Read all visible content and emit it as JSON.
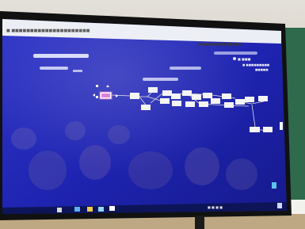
{
  "scene": {
    "description_tag": "photo-of-monitor",
    "colors": {
      "wall_top": "#d9d4cb",
      "wall_bottom": "#cdbfa9",
      "bezel": "#121212",
      "screen_dark": "#1a1a9c",
      "screen_light": "#2f34c8",
      "browser_bar": "#f3f3f6",
      "taskbar": "#0f1a60",
      "board": "#2e6b4e",
      "node": "#f4f4f4",
      "connector": "#dddddd"
    }
  },
  "browser": {
    "tab_text": "■ ■■■■■■■■■■■■■",
    "address_text": "■ ■■■■■■■■■■■■■■■■■■■■■"
  },
  "overlay": {
    "user_label": "■ ■■■",
    "info_lines": [
      "■ ■■■■■■■■■",
      "■■■■■"
    ]
  },
  "mindmap": {
    "root_label": "",
    "node_labels": [
      "",
      "",
      "",
      "",
      "",
      "",
      "",
      "",
      "",
      "",
      "",
      "",
      "",
      "",
      "",
      "",
      "",
      "",
      "",
      ""
    ]
  },
  "taskbar": {
    "icons": [
      "start-icon",
      "search-icon",
      "taskview-icon",
      "explorer-icon",
      "browser-icon"
    ],
    "tray_text": "■ ■ ■ ■"
  }
}
